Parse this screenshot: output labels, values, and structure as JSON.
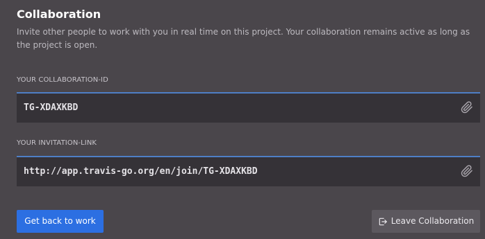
{
  "header": {
    "title": "Collaboration",
    "description": "Invite other people to work with you in real time on this project. Your collaboration remains active as long as the project is open."
  },
  "collaboration_id": {
    "label": "YOUR COLLABORATION-ID",
    "value": "TG-XDAXKBD",
    "copy_icon": "paperclip-icon"
  },
  "invitation_link": {
    "label": "YOUR INVITATION-LINK",
    "value": "http://app.travis-go.org/en/join/TG-XDAXKBD",
    "copy_icon": "paperclip-icon"
  },
  "actions": {
    "primary_label": "Get back to work",
    "leave_label": "Leave Collaboration",
    "leave_icon": "exit-icon"
  },
  "colors": {
    "background": "#4a464b",
    "field_background": "#353237",
    "field_accent": "#4e7fc6",
    "primary_button": "#2c6fe2",
    "secondary_button": "#5c585e"
  }
}
